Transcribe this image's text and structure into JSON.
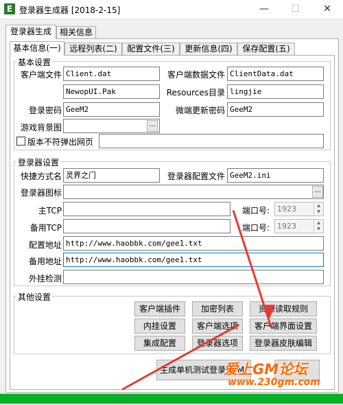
{
  "window": {
    "title": "登录器生成器 [2018-2-15]",
    "app_icon_letter": "E",
    "minimize_glyph": "—",
    "maximize_glyph": "☐",
    "close_glyph": "✕"
  },
  "outer_tabs": [
    "登录器生成",
    "相关信息"
  ],
  "inner_tabs": [
    "基本信息(一)",
    "远程列表(二)",
    "配置文件(三)",
    "更新信息(四)",
    "保存配置(五)"
  ],
  "basic": {
    "legend": "基本设置",
    "client_file_label": "客户端文件",
    "client_file_value": "Client.dat",
    "client_data_label": "客户端数据文件",
    "client_data_value": "ClientData.dat",
    "pak_value": "NewopUI.Pak",
    "resources_label": "Resources目录",
    "resources_value": "lingjie",
    "login_pwd_label": "登录密码",
    "login_pwd_value": "GeeM2",
    "micro_pwd_label": "微端更新密码",
    "micro_pwd_value": "GeeM2",
    "bg_label": "游戏背景图",
    "bg_value": "",
    "browse_glyph": "...",
    "version_check_label": "版本不符弹出网页",
    "version_check_checked": false,
    "version_url_value": ""
  },
  "launcher": {
    "legend": "登录器设置",
    "shortcut_label": "快捷方式名",
    "shortcut_value": "灵界之门",
    "config_file_label": "登录器配置文件",
    "config_file_value": "GeeM2.ini",
    "icon_label": "登录器图标",
    "icon_value": "",
    "browse_glyph": "...",
    "main_tcp_label": "主TCP",
    "main_tcp_value": "",
    "backup_tcp_label": "备用TCP",
    "backup_tcp_value": "",
    "port_label": "端口号:",
    "main_port_value": "1923",
    "backup_port_value": "1923",
    "config_addr_label": "配置地址",
    "config_addr_value": "http://www.haobbk.com/gee1.txt",
    "backup_addr_label": "备用地址",
    "backup_addr_value": "http://www.haobbk.com/gee1.txt",
    "plugin_check_label": "外挂检测",
    "plugin_check_value": ""
  },
  "other": {
    "legend": "其他设置",
    "buttons": [
      "客户端插件",
      "加密列表",
      "资源读取规则",
      "内挂设置",
      "客户端选项",
      "客户端界面设置",
      "集成配置",
      "登录器选项",
      "登录器皮肤编辑"
    ]
  },
  "bottom": {
    "generate_label": "生成单机测试登录器(M)",
    "watermark_text": "爱上GM论坛",
    "watermark_url": "www.230gm.com"
  },
  "progress": {
    "percent": 100
  },
  "colors": {
    "progress_green": "#06b025",
    "accent_red": "#e53935",
    "watermark_orange": "#ff6a00"
  }
}
